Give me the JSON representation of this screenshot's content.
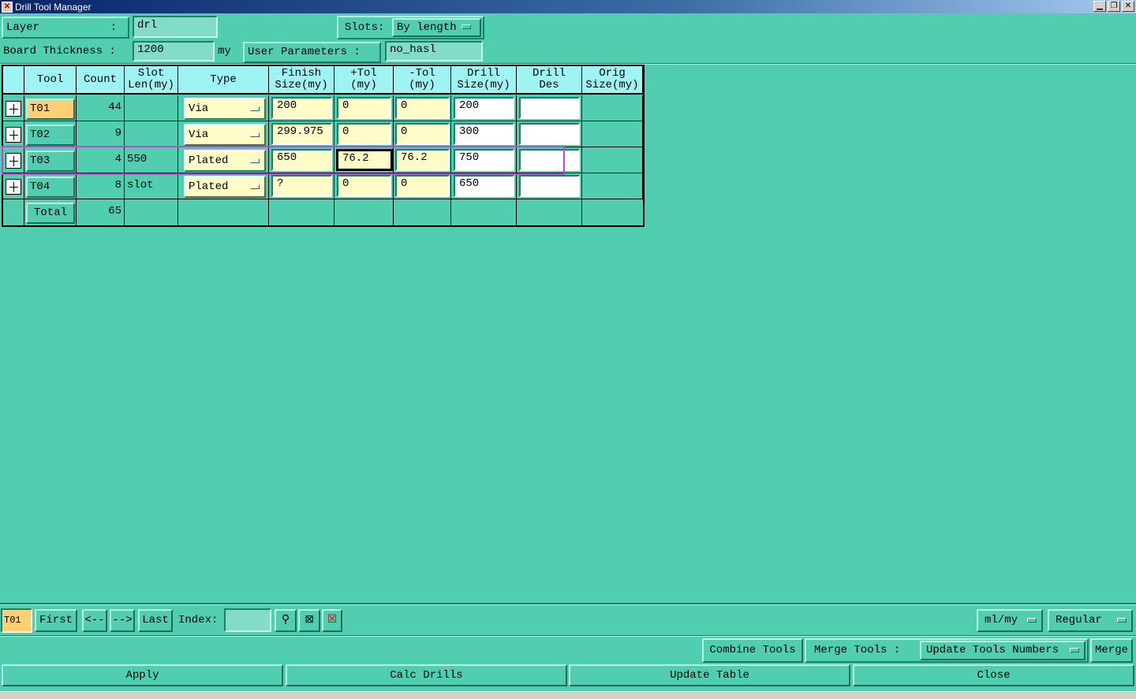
{
  "window": {
    "title": "Drill Tool Manager"
  },
  "top": {
    "layer_label": "Layer",
    "layer_colon": ":",
    "layer_value": "drl",
    "slots_label": "Slots:",
    "slots_value": "By length",
    "board_thickness_label": "Board Thickness :",
    "board_thickness_value": "1200",
    "board_thickness_unit": "my",
    "user_params_label": "User Parameters :",
    "user_params_value": "no_hasl"
  },
  "table": {
    "headers": {
      "tool": "Tool",
      "count": "Count",
      "slot_len": "Slot\nLen(my)",
      "type": "Type",
      "finish": "Finish\nSize(my)",
      "ptol": "+Tol\n(my)",
      "mtol": "-Tol\n(my)",
      "drill_size": "Drill\nSize(my)",
      "drill_des": "Drill\nDes",
      "orig": "Orig\nSize(my)"
    },
    "rows": [
      {
        "tool": "T01",
        "count": "44",
        "slot_len": "",
        "type": "Via",
        "finish": "200",
        "ptol": "0",
        "mtol": "0",
        "drill_size": "200",
        "drill_des": ""
      },
      {
        "tool": "T02",
        "count": "9",
        "slot_len": "",
        "type": "Via",
        "finish": "299.975",
        "ptol": "0",
        "mtol": "0",
        "drill_size": "300",
        "drill_des": ""
      },
      {
        "tool": "T03",
        "count": "4",
        "slot_len": "550",
        "type": "Plated",
        "finish": "650",
        "ptol": "76.2",
        "mtol": "76.2",
        "drill_size": "750",
        "drill_des": ""
      },
      {
        "tool": "T04",
        "count": "8",
        "slot_len": "slot",
        "type": "Plated",
        "finish": "?",
        "ptol": "0",
        "mtol": "0",
        "drill_size": "650",
        "drill_des": ""
      }
    ],
    "total_label": "Total",
    "total_count": "65"
  },
  "nav": {
    "current_tool": "T01",
    "first": "First",
    "prev": "<--",
    "next": "-->",
    "last": "Last",
    "index_label": "Index:",
    "index_value": "",
    "units": "ml/my",
    "mode": "Regular"
  },
  "actions": {
    "combine_tools": "Combine Tools",
    "merge_tools_label": "Merge Tools :",
    "merge_option": "Update Tools Numbers",
    "merge": "Merge",
    "apply": "Apply",
    "calc_drills": "Calc Drills",
    "update_table": "Update Table",
    "close": "Close"
  }
}
